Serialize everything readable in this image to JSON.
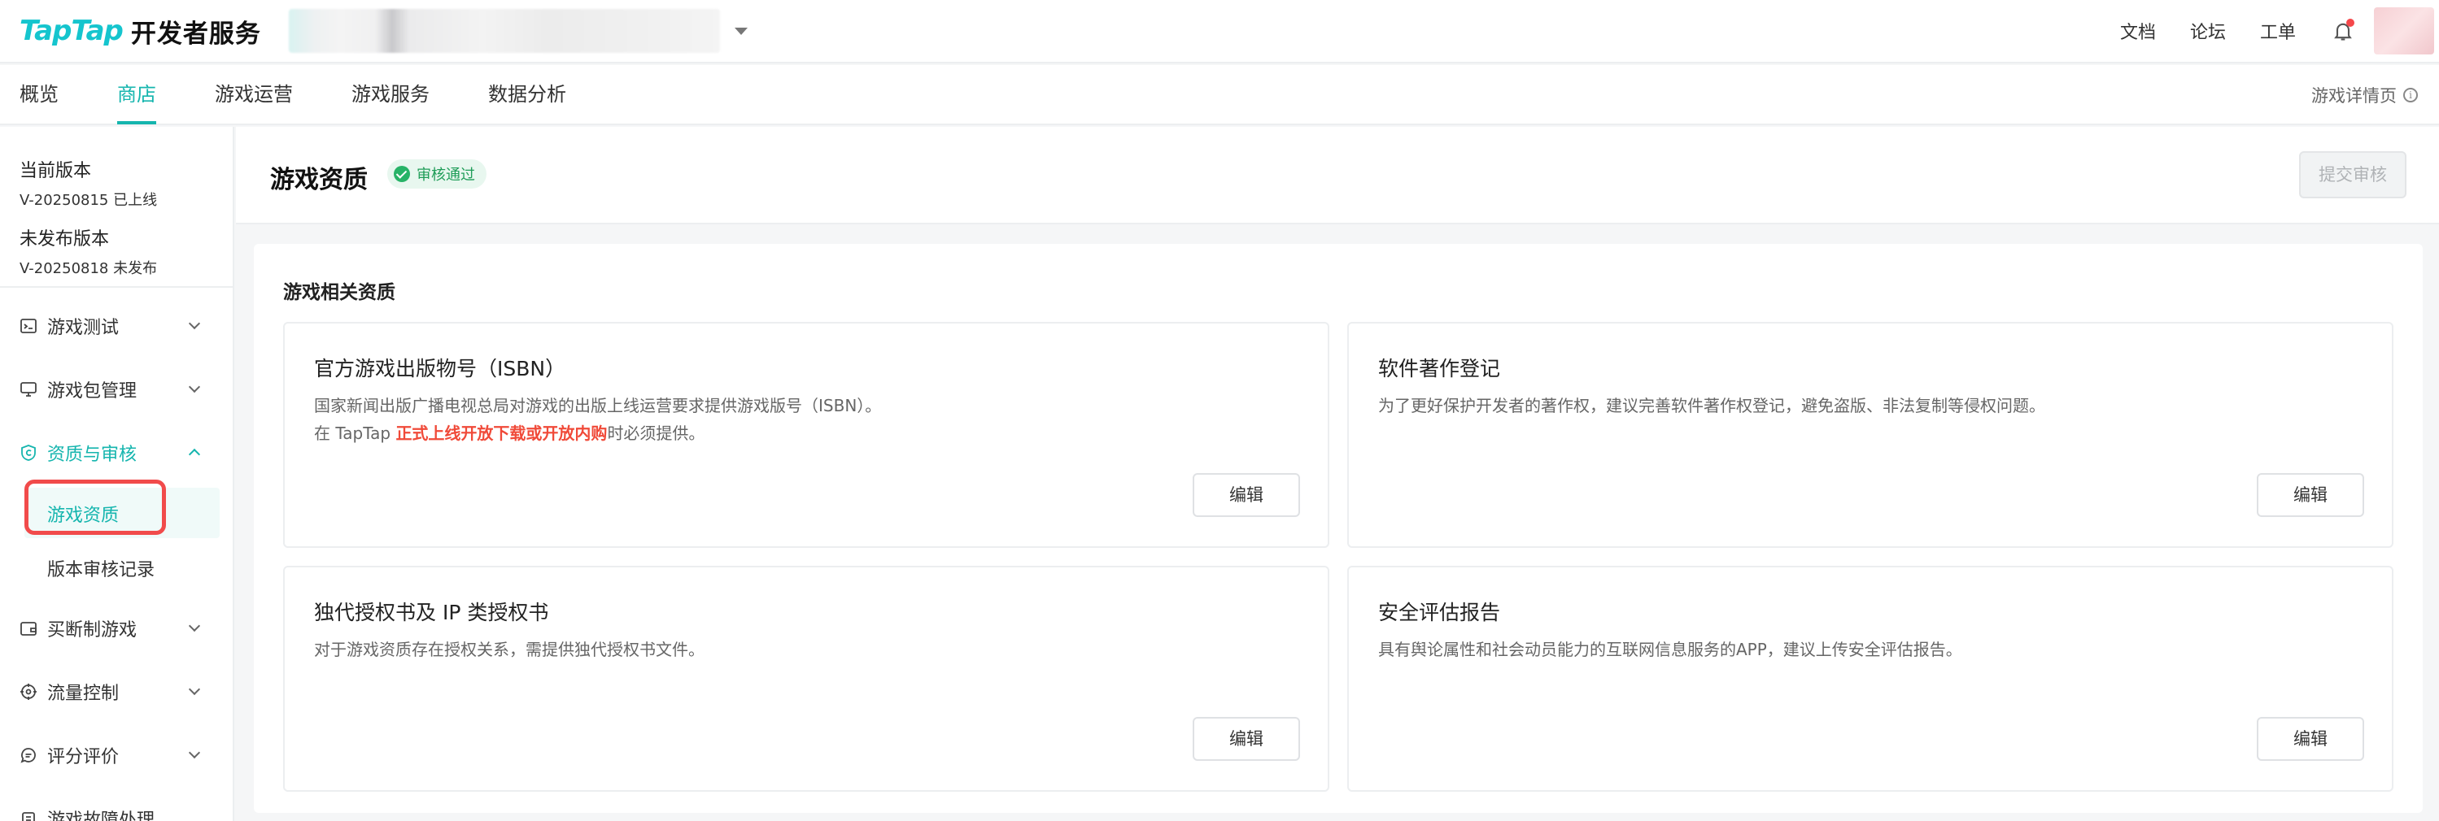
{
  "header": {
    "logo_tap": "TapTap",
    "logo_service": "开发者服务",
    "links": [
      "文档",
      "论坛",
      "工单"
    ]
  },
  "nav": {
    "tabs": [
      "概览",
      "商店",
      "游戏运营",
      "游戏服务",
      "数据分析"
    ],
    "active_tab": "商店",
    "detail_link": "游戏详情页"
  },
  "sidebar": {
    "current_version_title": "当前版本",
    "current_version_value": "V-20250815 已上线",
    "unpublished_version_title": "未发布版本",
    "unpublished_version_value": "V-20250818 未发布",
    "items": [
      {
        "label": "游戏测试",
        "icon": "terminal-icon"
      },
      {
        "label": "游戏包管理",
        "icon": "monitor-icon"
      },
      {
        "label": "资质与审核",
        "icon": "shield-icon"
      },
      {
        "label": "买断制游戏",
        "icon": "wallet-icon"
      },
      {
        "label": "流量控制",
        "icon": "target-icon"
      },
      {
        "label": "评分评价",
        "icon": "chat-icon"
      },
      {
        "label": "游戏故障处理",
        "icon": "bug-icon"
      }
    ],
    "sub_items": [
      "游戏资质",
      "版本审核记录"
    ]
  },
  "page": {
    "title": "游戏资质",
    "status_badge": "审核通过",
    "submit_button": "提交审核",
    "section_title": "游戏相关资质"
  },
  "cards": [
    {
      "title": "官方游戏出版物号（ISBN）",
      "desc_line1": "国家新闻出版广播电视总局对游戏的出版上线运营要求提供游戏版号（ISBN）。",
      "desc_line2_prefix": "在 TapTap ",
      "desc_line2_highlight": "正式上线开放下载或开放内购",
      "desc_line2_suffix": "时必须提供。",
      "button": "编辑"
    },
    {
      "title": "软件著作登记",
      "desc_line1": "为了更好保护开发者的著作权，建议完善软件著作权登记，避免盗版、非法复制等侵权问题。",
      "button": "编辑"
    },
    {
      "title": "独代授权书及 IP 类授权书",
      "desc_line1": "对于游戏资质存在授权关系，需提供独代授权书文件。",
      "button": "编辑"
    },
    {
      "title": "安全评估报告",
      "desc_line1": "具有舆论属性和社会动员能力的互联网信息服务的APP，建议上传安全评估报告。",
      "button": "编辑"
    }
  ],
  "colors": {
    "accent": "#15b5ae",
    "brand": "#15c5ce",
    "highlight_red": "#f04a39",
    "annotation_box": "#f14b4b",
    "badge_green": "#27b367"
  }
}
